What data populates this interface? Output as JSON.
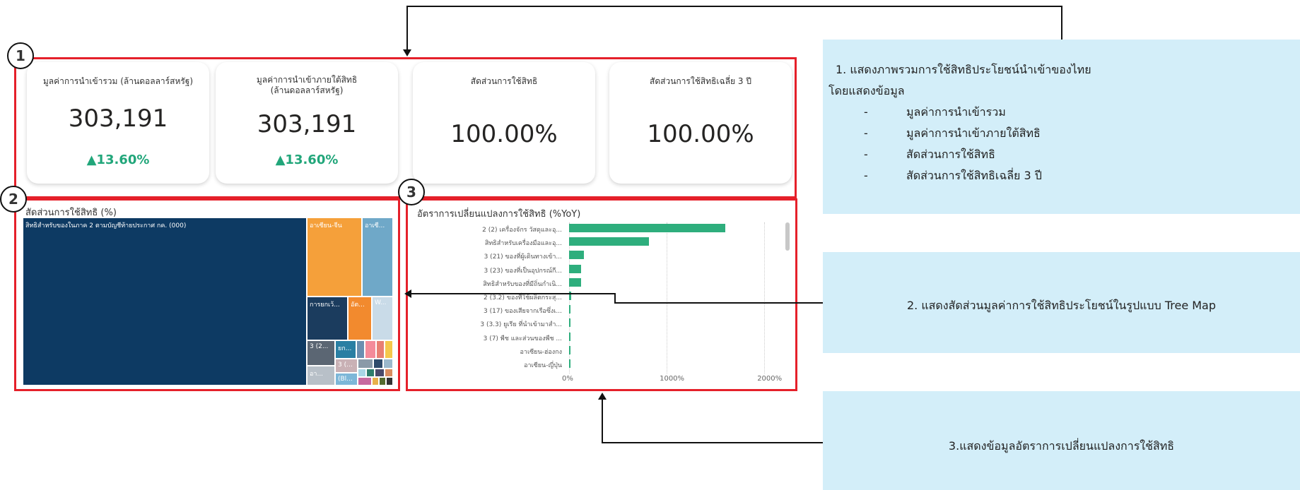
{
  "cards": [
    {
      "title": "มูลค่าการนำเข้ารวม (ล้านดอลลาร์สหรัฐ)",
      "value": "303,191",
      "delta": "▲13.60%"
    },
    {
      "title": "มูลค่าการนำเข้าภายใต้สิทธิ\n(ล้านดอลลาร์สหรัฐ)",
      "value": "303,191",
      "delta": "▲13.60%"
    },
    {
      "title": "สัดส่วนการใช้สิทธิ",
      "value": "100.00%",
      "delta": ""
    },
    {
      "title": "สัดส่วนการใช้สิทธิเฉลี่ย 3 ปี",
      "value": "100.00%",
      "delta": ""
    }
  ],
  "badges": [
    "1",
    "2",
    "3"
  ],
  "treemap": {
    "title": "สัดส่วนการใช้สิทธิ (%)",
    "tiles": [
      {
        "label": "สิทธิสำหรับของในภาค 2 ตามบัญชีท้ายประกาศ กค. (000)",
        "color": "#0d3a63"
      },
      {
        "label": "อาเซียน-จีน",
        "color": "#f5a03a"
      },
      {
        "label": "อาเซี...",
        "color": "#6fa8c8"
      },
      {
        "label": "การยกเว้...",
        "color": "#1b3c5e"
      },
      {
        "label": "อัต...",
        "color": "#f28a2e"
      },
      {
        "label": "W...",
        "color": "#c9dbe8"
      },
      {
        "label": "3 (2...",
        "color": "#5b6673"
      },
      {
        "label": "ยก...",
        "color": "#2a7fa3"
      },
      {
        "label": "3 (...",
        "color": "#c9b1b5"
      },
      {
        "label": "อา...",
        "color": "#b8c0c8"
      },
      {
        "label": "(Bl...",
        "color": "#7db7d8"
      }
    ]
  },
  "barchart": {
    "title": "อัตราการเปลี่ยนแปลงการใช้สิทธิ (%YoY)",
    "chart_data": {
      "type": "bar",
      "orientation": "horizontal",
      "categories": [
        "2 (2) เครื่องจักร วัสดุและอุ...",
        "สิทธิสำหรับเครื่องมือและอุ...",
        "3 (21) ของที่ผู้เดินทางเข้า...",
        "3 (23) ของที่เป็นอุปกรณ์กี...",
        "สิทธิสำหรับของที่มีถิ่นกำเนิ...",
        "2 (3.2) ของที่ใช้ผลิตกระสุ...",
        "3 (17) ของเสียจากเรือซึ่งเ...",
        "3 (3.3) ยูเรีย ที่นำเข้ามาสำ...",
        "3 (7) พืช และส่วนของพืช ...",
        "อาเซียน-ฮ่องกง",
        "อาเซียน-ญี่ปุ่น"
      ],
      "values": [
        1600,
        820,
        150,
        120,
        120,
        25,
        12,
        10,
        8,
        4,
        3
      ],
      "xlim": [
        0,
        2100
      ],
      "ticks": [
        "0%",
        "1000%",
        "2000%"
      ],
      "tick_values": [
        0,
        1000,
        2000
      ]
    }
  },
  "callouts": {
    "c1": {
      "line1": "1. แสดงภาพรวมการใช้สิทธิประโยชน์นำเข้าของไทย",
      "line2": "โดยแสดงข้อมูล",
      "items": [
        "มูลค่าการนำเข้ารวม",
        "มูลค่าการนำเข้าภายใต้สิทธิ",
        "สัดส่วนการใช้สิทธิ",
        "สัดส่วนการใช้สิทธิเฉลี่ย 3 ปี"
      ],
      "dash": "-"
    },
    "c2": "2. แสดงสัดส่วนมูลค่าการใช้สิทธิประโยชน์ในรูปแบบ Tree Map",
    "c3": "3.แสดงข้อมูลอัตราการเปลี่ยนแปลงการใช้สิทธิ"
  }
}
